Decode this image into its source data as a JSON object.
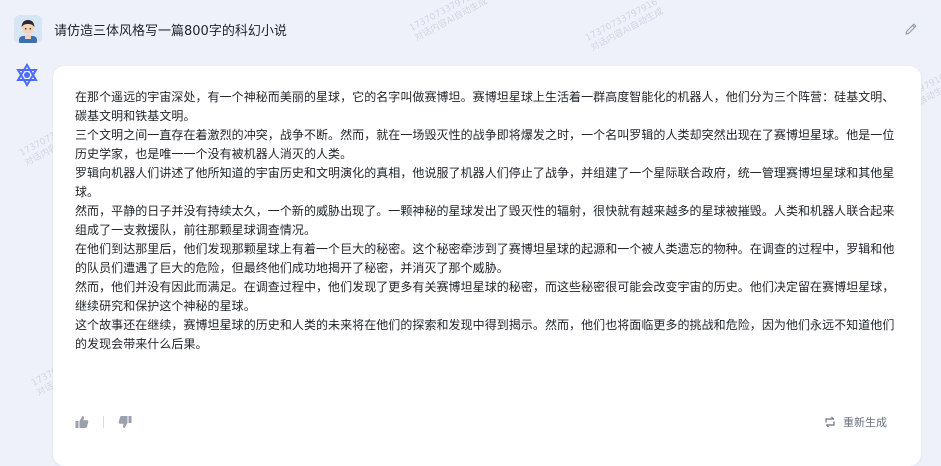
{
  "user": {
    "prompt": "请仿造三体风格写一篇800字的科幻小说"
  },
  "answer": {
    "paragraphs": [
      "在那个遥远的宇宙深处，有一个神秘而美丽的星球，它的名字叫做赛博坦。赛博坦星球上生活着一群高度智能化的机器人，他们分为三个阵营：硅基文明、碳基文明和铁基文明。",
      "三个文明之间一直存在着激烈的冲突，战争不断。然而，就在一场毁灭性的战争即将爆发之时，一个名叫罗辑的人类却突然出现在了赛博坦星球。他是一位历史学家，也是唯一一个没有被机器人消灭的人类。",
      "罗辑向机器人们讲述了他所知道的宇宙历史和文明演化的真相，他说服了机器人们停止了战争，并组建了一个星际联合政府，统一管理赛博坦星球和其他星球。",
      "然而，平静的日子并没有持续太久，一个新的威胁出现了。一颗神秘的星球发出了毁灭性的辐射，很快就有越来越多的星球被摧毁。人类和机器人联合起来组成了一支救援队，前往那颗星球调查情况。",
      "在他们到达那里后，他们发现那颗星球上有着一个巨大的秘密。这个秘密牵涉到了赛博坦星球的起源和一个被人类遗忘的物种。在调查的过程中，罗辑和他的队员们遭遇了巨大的危险，但最终他们成功地揭开了秘密，并消灭了那个威胁。",
      "然而，他们并没有因此而满足。在调查过程中，他们发现了更多有关赛博坦星球的秘密，而这些秘密很可能会改变宇宙的历史。他们决定留在赛博坦星球，继续研究和保护这个神秘的星球。",
      "这个故事还在继续，赛博坦星球的历史和人类的未来将在他们的探索和发现中得到揭示。然而，他们也将面临更多的挑战和危险，因为他们永远不知道他们的发现会带来什么后果。"
    ]
  },
  "actions": {
    "regenerate_label": "重新生成"
  },
  "watermark": {
    "line1": "17370733797916",
    "line2": "对话内容AI自动生成"
  },
  "colors": {
    "background": "#eef1fa",
    "card": "#ffffff",
    "logo": "#4d6bfe",
    "muted": "#6b7280"
  },
  "icons": {
    "avatar": "user-avatar",
    "logo": "assistant-logo-icon",
    "edit": "edit-pencil-icon",
    "like": "thumbs-up-icon",
    "dislike": "thumbs-down-icon",
    "regenerate": "regenerate-icon"
  }
}
